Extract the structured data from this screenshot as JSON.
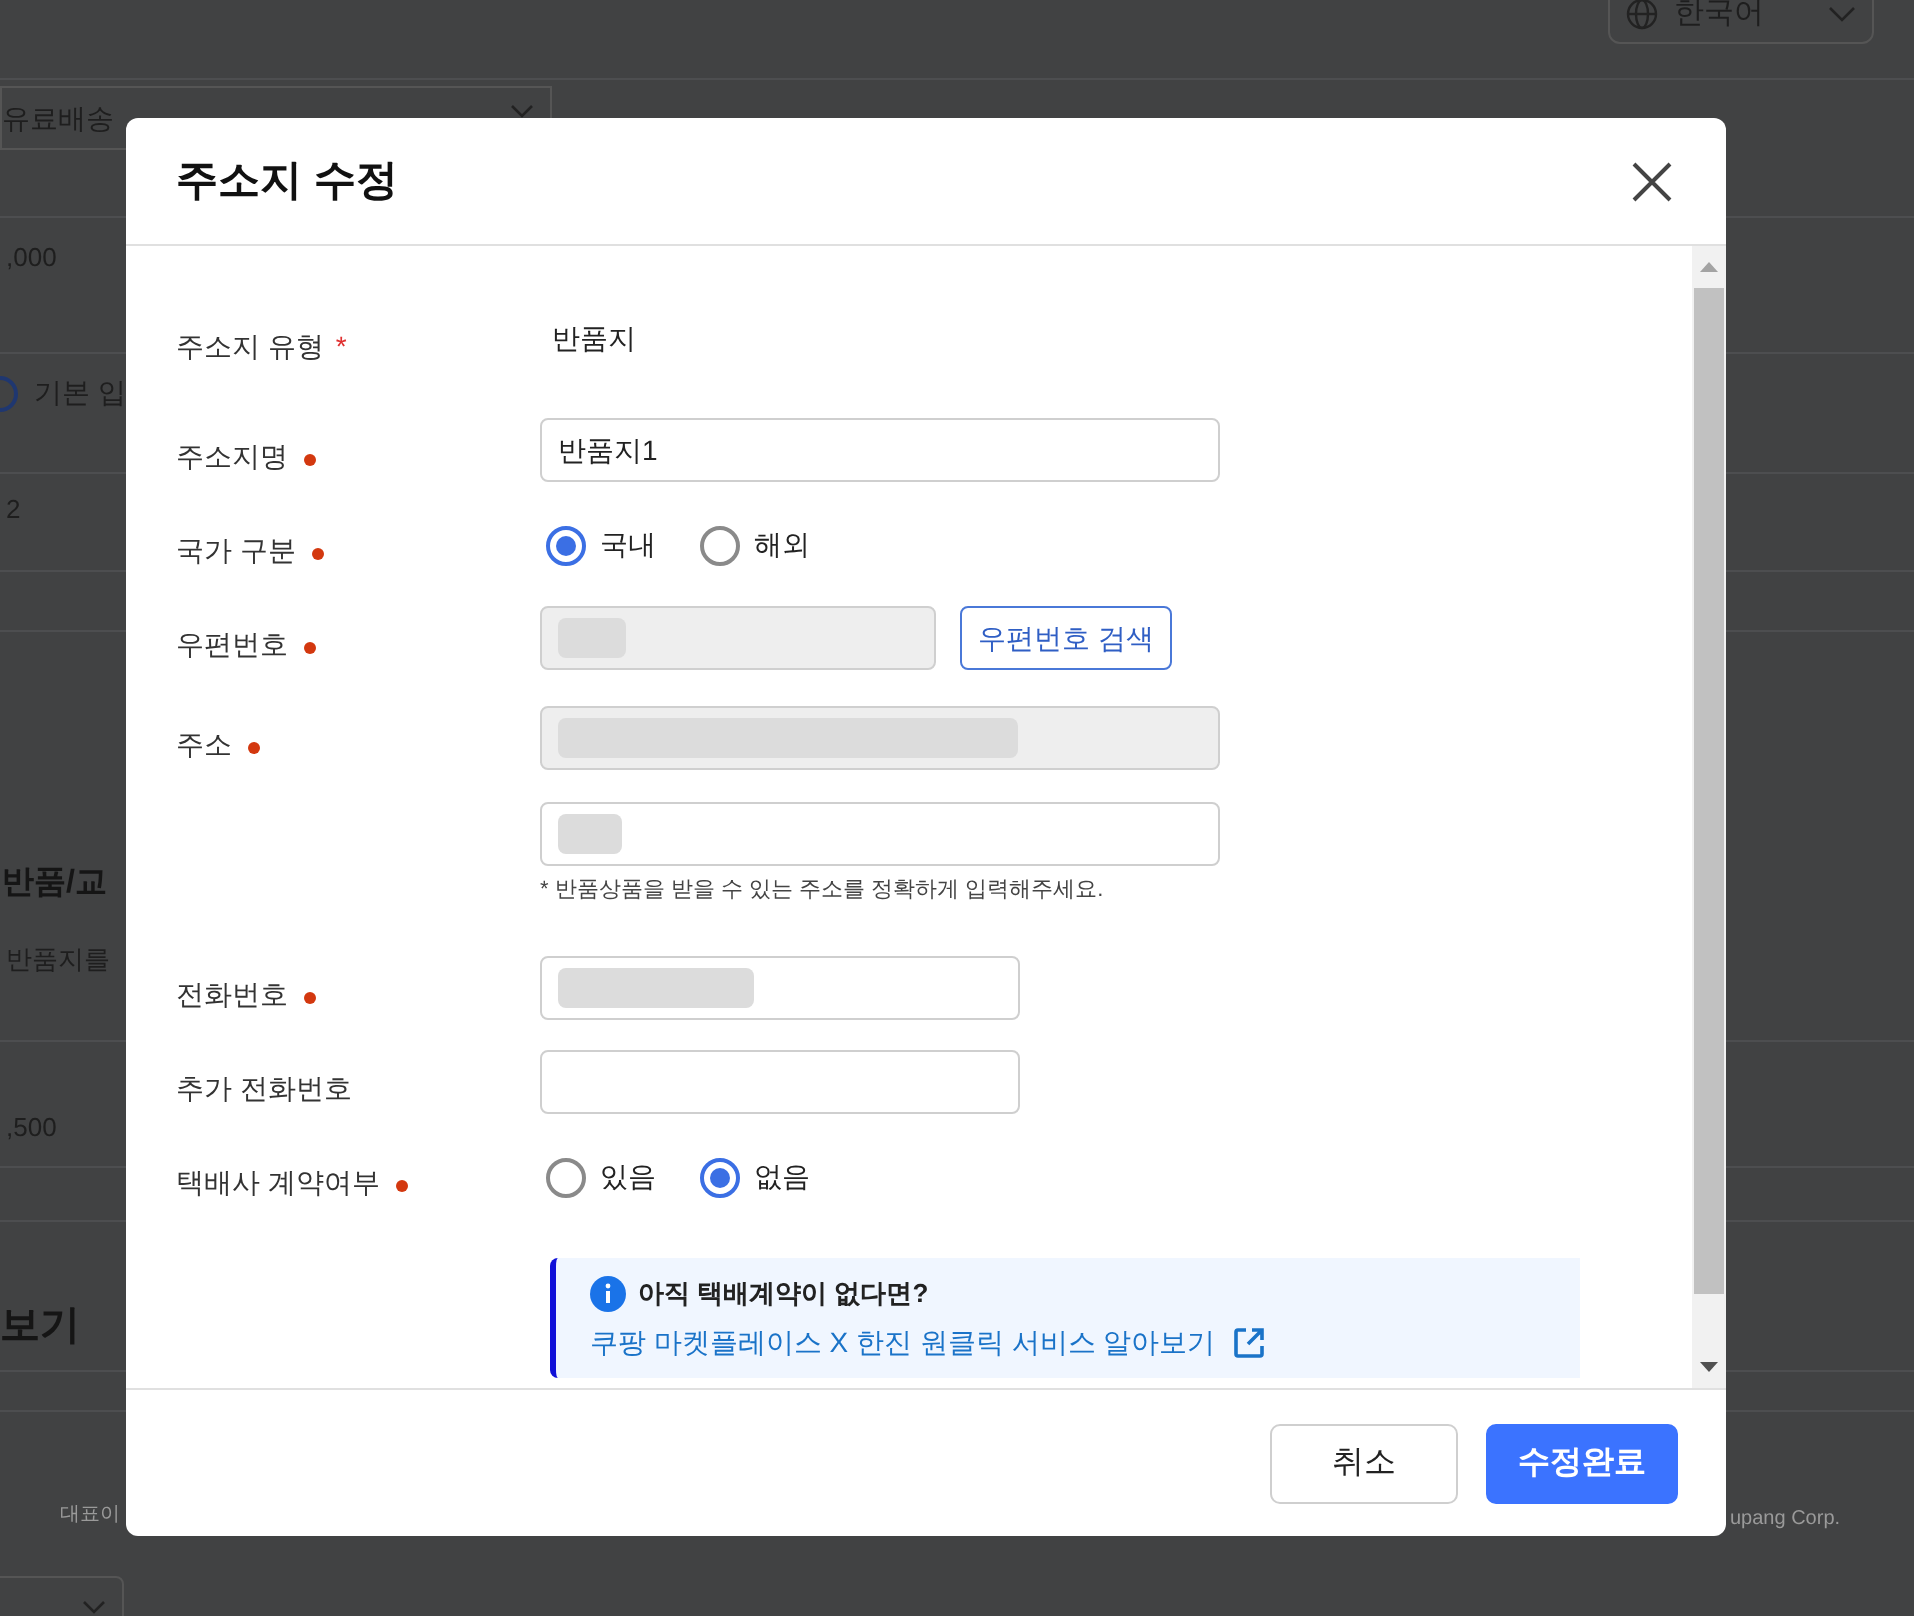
{
  "background": {
    "language_select": "한국어",
    "texts": [
      {
        "kind": "select",
        "text": "유료배송"
      },
      {
        "kind": "cell",
        "text": ",000"
      },
      {
        "kind": "radio",
        "text": "기본 입"
      },
      {
        "kind": "cell",
        "text": "2"
      },
      {
        "kind": "heading",
        "text": "반품/교"
      },
      {
        "kind": "cell",
        "text": "반품지를"
      },
      {
        "kind": "cell",
        "text": ",500"
      },
      {
        "kind": "heading",
        "text": "보기"
      },
      {
        "kind": "footer",
        "text": "대표이"
      },
      {
        "kind": "footer",
        "text": "upang Corp."
      }
    ]
  },
  "dialog": {
    "title": "주소지 수정",
    "fields": [
      {
        "kind": "static",
        "label": "주소지 유형",
        "required_mark": "*",
        "value": "반품지"
      },
      {
        "kind": "input",
        "label": "주소지명",
        "required": true,
        "value": "반품지1"
      },
      {
        "kind": "radio",
        "label": "국가 구분",
        "required": true,
        "options": [
          {
            "label": "국내",
            "selected": true
          },
          {
            "label": "해외",
            "selected": false
          }
        ]
      },
      {
        "kind": "postal",
        "label": "우편번호",
        "required": true,
        "redacted": true,
        "button": "우편번호 검색"
      },
      {
        "kind": "address",
        "label": "주소",
        "required": true,
        "redacted": true,
        "hint": "* 반품상품을 받을 수 있는 주소를 정확하게 입력해주세요."
      },
      {
        "kind": "input",
        "label": "전화번호",
        "required": true,
        "redacted": true
      },
      {
        "kind": "input",
        "label": "추가 전화번호",
        "required": false
      },
      {
        "kind": "radio",
        "label": "택배사 계약여부",
        "required": true,
        "options": [
          {
            "label": "있음",
            "selected": false
          },
          {
            "label": "없음",
            "selected": true
          }
        ]
      },
      {
        "kind": "notice",
        "title": "아직 택배계약이 없다면?",
        "link": "쿠팡 마켓플레이스 X 한진 원클릭 서비스 알아보기"
      }
    ],
    "buttons": [
      {
        "kind": "secondary",
        "label": "취소"
      },
      {
        "kind": "primary",
        "label": "수정완료"
      }
    ]
  }
}
